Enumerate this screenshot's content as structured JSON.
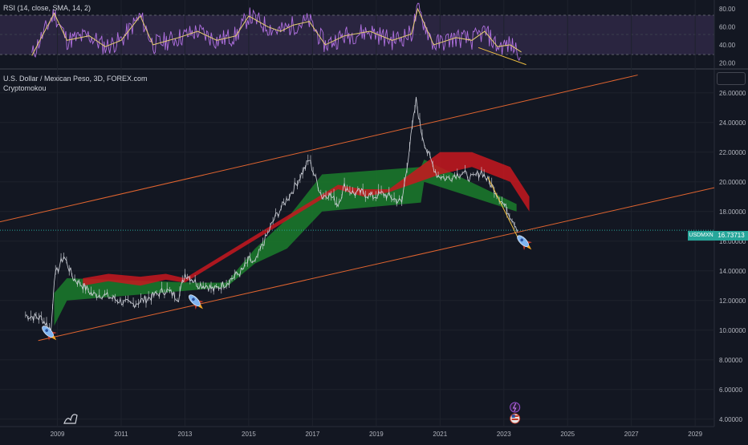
{
  "rsi_pane": {
    "legend": "RSI (14, close, SMA, 14, 2)",
    "axis_ticks": [
      "80.00",
      "60.00",
      "40.00",
      "20.00"
    ]
  },
  "main_pane": {
    "symbol_legend": "U.S. Dollar / Mexican Peso, 3D, FOREX.com",
    "indicator_legend": "Cryptomokou",
    "price_ticks": [
      "26.00000",
      "24.00000",
      "22.00000",
      "20.00000",
      "18.00000",
      "16.00000",
      "14.00000",
      "12.00000",
      "10.00000",
      "8.00000",
      "6.00000",
      "4.00000"
    ],
    "time_ticks": [
      "2009",
      "2011",
      "2013",
      "2015",
      "2017",
      "2019",
      "2021",
      "2023",
      "2025",
      "2027",
      "2029"
    ],
    "last_price_label": "USDMXN",
    "last_price_value": "16.73713"
  },
  "colors": {
    "background": "#131722",
    "candles": "#d1d4dc",
    "bull_cloud": "#1b7d2c",
    "bear_cloud": "#c8181e",
    "channel_lines": "#e0642f",
    "rsi_line": "#b070e0",
    "rsi_signal": "#e8d070",
    "last_price": "#26a69a"
  },
  "chart_data": [
    {
      "type": "line",
      "title": "RSI (14, close, SMA, 14, 2)",
      "ylim": [
        15,
        88
      ],
      "yticks": [
        80,
        60,
        40,
        20
      ],
      "bands": [
        70,
        50,
        30
      ],
      "x": [
        2008.2,
        2008.6,
        2008.9,
        2009.3,
        2010.0,
        2010.5,
        2011.0,
        2011.6,
        2012.0,
        2012.8,
        2013.4,
        2014.0,
        2014.6,
        2015.0,
        2015.6,
        2016.0,
        2016.4,
        2016.9,
        2017.4,
        2018.0,
        2018.8,
        2019.5,
        2020.1,
        2020.3,
        2020.8,
        2021.5,
        2022.0,
        2022.4,
        2022.8,
        2023.2,
        2023.55
      ],
      "series": [
        {
          "values": [
            28,
            55,
            75,
            45,
            50,
            38,
            45,
            72,
            40,
            48,
            55,
            45,
            50,
            72,
            60,
            55,
            62,
            66,
            40,
            50,
            55,
            45,
            52,
            80,
            40,
            48,
            45,
            55,
            38,
            40,
            32
          ]
        }
      ],
      "trendline": {
        "x": [
          2022.2,
          2023.7
        ],
        "y": [
          37,
          18
        ]
      }
    },
    {
      "type": "line",
      "title": "U.S. Dollar / Mexican Peso, 3D, FOREX.com",
      "ylim": [
        3.5,
        27.5
      ],
      "y_ticks": [
        26,
        24,
        22,
        20,
        18,
        16,
        14,
        12,
        10,
        8,
        6,
        4
      ],
      "xlim": [
        2007.2,
        2029.6
      ],
      "x_ticks": [
        "2009",
        "2011",
        "2013",
        "2015",
        "2017",
        "2019",
        "2021",
        "2023",
        "2025",
        "2027",
        "2029"
      ],
      "series": [
        {
          "values": [
            11.0,
            10.8,
            10.3,
            10.0,
            13.5,
            15.0,
            13.5,
            13.0,
            12.4,
            12.4,
            11.7,
            12.2,
            12.7,
            12.2,
            13.8,
            13.5,
            13.1,
            13.0,
            12.7,
            13.2,
            13.7,
            14.0,
            14.7,
            14.5,
            15.6,
            16.5,
            17.5,
            18.5,
            19.5,
            21.5,
            20.2,
            19.0,
            19.2,
            18.5,
            19.7,
            19.2,
            19.3,
            19.0,
            19.2,
            18.6,
            25.5,
            23.5,
            22.0,
            20.5,
            20.2,
            20.5,
            20.6,
            20.2,
            20.7,
            19.5,
            17.4,
            16.73713
          ],
          "x": [
            2008.0,
            2008.5,
            2008.7,
            2008.8,
            2008.9,
            2009.2,
            2009.5,
            2009.8,
            2010.1,
            2010.4,
            2011.3,
            2011.9,
            2012.4,
            2012.8,
            2013.0,
            2013.2,
            2013.4,
            2013.7,
            2013.9,
            2014.3,
            2014.6,
            2014.8,
            2015.0,
            2015.2,
            2015.4,
            2015.6,
            2015.8,
            2016.1,
            2016.4,
            2016.9,
            2017.1,
            2017.3,
            2017.5,
            2017.8,
            2018.0,
            2018.3,
            2018.5,
            2018.9,
            2019.2,
            2019.8,
            2020.25,
            2020.4,
            2020.6,
            2020.9,
            2021.2,
            2021.5,
            2021.7,
            2022.0,
            2022.3,
            2022.7,
            2023.3,
            2023.45
          ]
        }
      ],
      "bull_cloud": {
        "x": [
          2008.9,
          2009.3,
          2013.3,
          2014.3,
          2015.2,
          2016.2,
          2017.3,
          2020.4,
          2020.5,
          2023.4
        ],
        "upper": [
          12.5,
          13.5,
          13.2,
          13.2,
          15.5,
          17.5,
          20.5,
          21.0,
          21.5,
          18.5
        ],
        "lower": [
          10.3,
          12.0,
          12.7,
          12.9,
          14.5,
          15.5,
          18.0,
          18.6,
          20.0,
          18.0
        ]
      },
      "bear_cloud": {
        "x": [
          2009.8,
          2010.6,
          2011.6,
          2012.4,
          2013.0,
          2017.8,
          2018.6,
          2019.4,
          2021.0,
          2022.0,
          2023.2,
          2023.8
        ],
        "upper": [
          13.5,
          13.8,
          13.6,
          13.8,
          13.5,
          19.8,
          19.5,
          19.5,
          22.0,
          22.0,
          21.0,
          19.0
        ],
        "lower": [
          13.0,
          13.3,
          13.0,
          13.4,
          13.2,
          19.5,
          19.0,
          19.3,
          20.5,
          21.0,
          20.0,
          18.0
        ]
      },
      "channel_upper": {
        "x": [
          2007.2,
          2027.2
        ],
        "y": [
          17.3,
          27.2
        ]
      },
      "channel_lower": {
        "x": [
          2008.4,
          2029.6
        ],
        "y": [
          9.3,
          19.6
        ]
      },
      "last_value": 16.73713
    }
  ]
}
